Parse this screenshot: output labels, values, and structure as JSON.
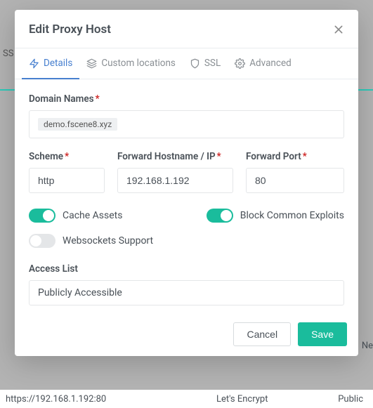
{
  "modal": {
    "title": "Edit Proxy Host",
    "tabs": {
      "details": "Details",
      "custom_locations": "Custom locations",
      "ssl": "SSL",
      "advanced": "Advanced"
    },
    "labels": {
      "domain_names": "Domain Names",
      "scheme": "Scheme",
      "forward_host": "Forward Hostname / IP",
      "forward_port": "Forward Port",
      "access_list": "Access List"
    },
    "values": {
      "domain_tag": "demo.fscene8.xyz",
      "scheme": "http",
      "forward_host": "192.168.1.192",
      "forward_port": "80",
      "access_list": "Publicly Accessible"
    },
    "toggles": {
      "cache_assets": "Cache Assets",
      "block_exploits": "Block Common Exploits",
      "websockets": "Websockets Support"
    },
    "buttons": {
      "cancel": "Cancel",
      "save": "Save"
    }
  },
  "background": {
    "left_hint": "SS",
    "right_hint": "Ne",
    "row_host": "https://192.168.1.192:80",
    "row_cert": "Let's Encrypt",
    "row_access": "Public"
  }
}
